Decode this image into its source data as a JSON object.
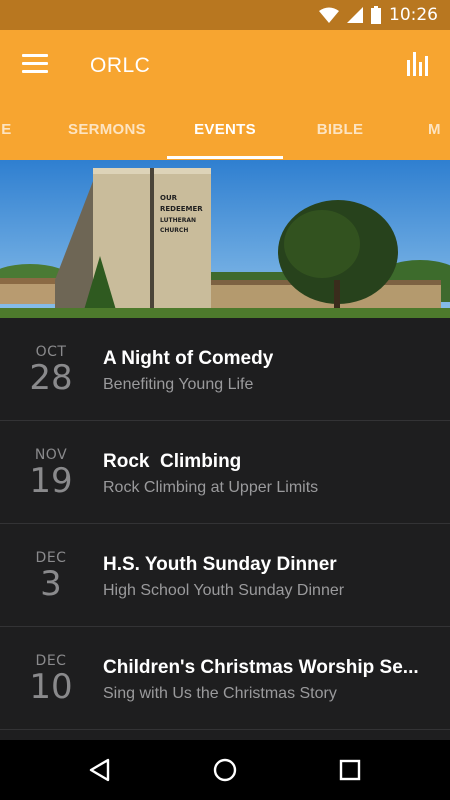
{
  "status": {
    "time": "10:26"
  },
  "app": {
    "title": "ORLC"
  },
  "tabs": [
    {
      "label": "HOME",
      "display": "ME"
    },
    {
      "label": "SERMONS"
    },
    {
      "label": "EVENTS",
      "active": true
    },
    {
      "label": "BIBLE"
    },
    {
      "label": "MORE",
      "display": "M"
    }
  ],
  "banner": {
    "sign_lines": [
      "OUR",
      "REDEEMER",
      "LUTHERAN",
      "CHURCH"
    ]
  },
  "events": [
    {
      "month": "OCT",
      "day": "28",
      "title": "A Night of Comedy",
      "subtitle": "Benefiting Young Life"
    },
    {
      "month": "NOV",
      "day": "19",
      "title": "Rock  Climbing",
      "subtitle": "Rock Climbing at Upper Limits"
    },
    {
      "month": "DEC",
      "day": "3",
      "title": "H.S. Youth Sunday Dinner",
      "subtitle": "High School Youth Sunday Dinner"
    },
    {
      "month": "DEC",
      "day": "10",
      "title": "Children's Christmas Worship Se...",
      "subtitle": "Sing with Us the Christmas Story"
    }
  ],
  "colors": {
    "accent": "#f7a530",
    "status_bar": "#b87720",
    "background": "#1e1e1f"
  },
  "icons": [
    "wifi-icon",
    "signal-icon",
    "battery-icon",
    "menu-icon",
    "bar-chart-icon",
    "back-icon",
    "home-icon",
    "recents-icon"
  ]
}
